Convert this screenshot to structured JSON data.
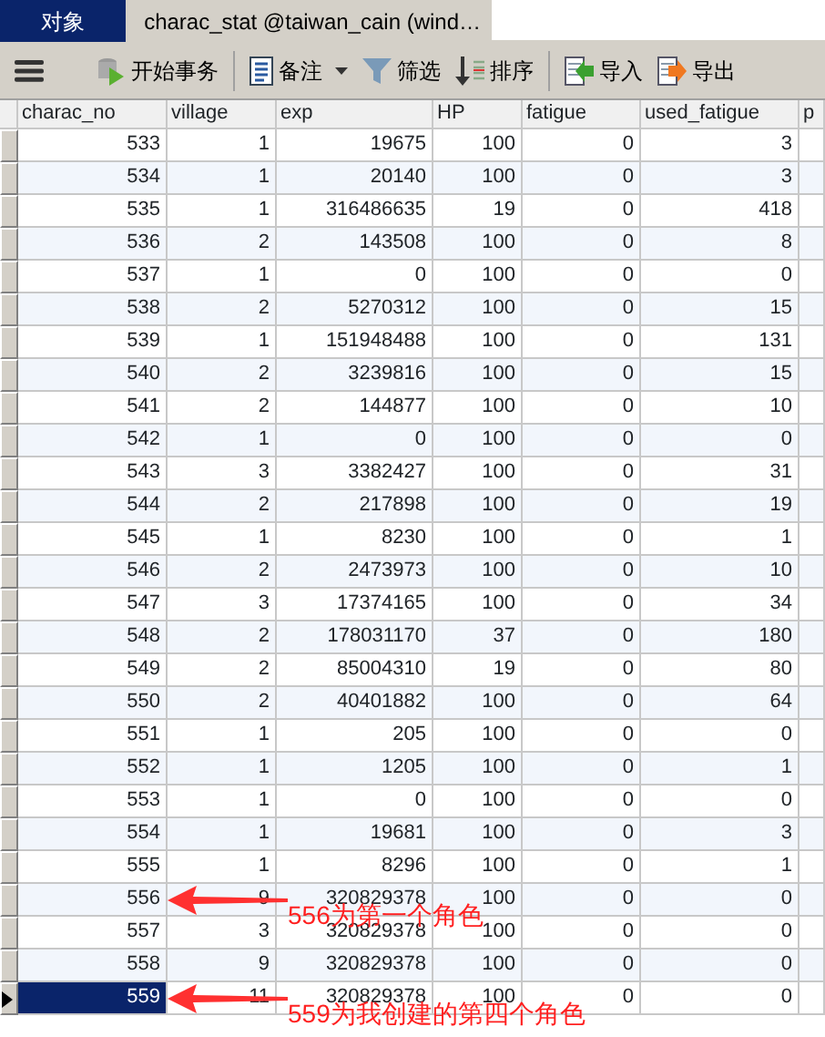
{
  "tabs": [
    {
      "label": "对象",
      "selected": true,
      "kind": "plain"
    },
    {
      "label": "charac_stat @taiwan_cain (wind…",
      "selected": false,
      "kind": "table"
    }
  ],
  "toolbar": [
    {
      "kind": "menu"
    },
    {
      "kind": "transaction",
      "label": "开始事务"
    },
    {
      "kind": "note",
      "label": "备注"
    },
    {
      "kind": "filter",
      "label": "筛选"
    },
    {
      "kind": "sort",
      "label": "排序"
    },
    {
      "kind": "import",
      "label": "导入"
    },
    {
      "kind": "export",
      "label": "导出"
    }
  ],
  "table": {
    "columns": [
      "charac_no",
      "village",
      "exp",
      "HP",
      "fatigue",
      "used_fatigue",
      "p"
    ],
    "rows": [
      {
        "cells": [
          "533",
          "1",
          "19675",
          "100",
          "0",
          "3"
        ],
        "selected": false
      },
      {
        "cells": [
          "534",
          "1",
          "20140",
          "100",
          "0",
          "3"
        ],
        "selected": false
      },
      {
        "cells": [
          "535",
          "1",
          "316486635",
          "19",
          "0",
          "418"
        ],
        "selected": false
      },
      {
        "cells": [
          "536",
          "2",
          "143508",
          "100",
          "0",
          "8"
        ],
        "selected": false
      },
      {
        "cells": [
          "537",
          "1",
          "0",
          "100",
          "0",
          "0"
        ],
        "selected": false
      },
      {
        "cells": [
          "538",
          "2",
          "5270312",
          "100",
          "0",
          "15"
        ],
        "selected": false
      },
      {
        "cells": [
          "539",
          "1",
          "151948488",
          "100",
          "0",
          "131"
        ],
        "selected": false
      },
      {
        "cells": [
          "540",
          "2",
          "3239816",
          "100",
          "0",
          "15"
        ],
        "selected": false
      },
      {
        "cells": [
          "541",
          "2",
          "144877",
          "100",
          "0",
          "10"
        ],
        "selected": false
      },
      {
        "cells": [
          "542",
          "1",
          "0",
          "100",
          "0",
          "0"
        ],
        "selected": false
      },
      {
        "cells": [
          "543",
          "3",
          "3382427",
          "100",
          "0",
          "31"
        ],
        "selected": false
      },
      {
        "cells": [
          "544",
          "2",
          "217898",
          "100",
          "0",
          "19"
        ],
        "selected": false
      },
      {
        "cells": [
          "545",
          "1",
          "8230",
          "100",
          "0",
          "1"
        ],
        "selected": false
      },
      {
        "cells": [
          "546",
          "2",
          "2473973",
          "100",
          "0",
          "10"
        ],
        "selected": false
      },
      {
        "cells": [
          "547",
          "3",
          "17374165",
          "100",
          "0",
          "34"
        ],
        "selected": false
      },
      {
        "cells": [
          "548",
          "2",
          "178031170",
          "37",
          "0",
          "180"
        ],
        "selected": false
      },
      {
        "cells": [
          "549",
          "2",
          "85004310",
          "19",
          "0",
          "80"
        ],
        "selected": false
      },
      {
        "cells": [
          "550",
          "2",
          "40401882",
          "100",
          "0",
          "64"
        ],
        "selected": false
      },
      {
        "cells": [
          "551",
          "1",
          "205",
          "100",
          "0",
          "0"
        ],
        "selected": false
      },
      {
        "cells": [
          "552",
          "1",
          "1205",
          "100",
          "0",
          "1"
        ],
        "selected": false
      },
      {
        "cells": [
          "553",
          "1",
          "0",
          "100",
          "0",
          "0"
        ],
        "selected": false
      },
      {
        "cells": [
          "554",
          "1",
          "19681",
          "100",
          "0",
          "3"
        ],
        "selected": false
      },
      {
        "cells": [
          "555",
          "1",
          "8296",
          "100",
          "0",
          "1"
        ],
        "selected": false
      },
      {
        "cells": [
          "556",
          "9",
          "320829378",
          "100",
          "0",
          "0"
        ],
        "selected": false,
        "note": "556为第一个角色"
      },
      {
        "cells": [
          "557",
          "3",
          "320829378",
          "100",
          "0",
          "0"
        ],
        "selected": false
      },
      {
        "cells": [
          "558",
          "9",
          "320829378",
          "100",
          "0",
          "0"
        ],
        "selected": false
      },
      {
        "cells": [
          "559",
          "11",
          "320829378",
          "100",
          "0",
          "0"
        ],
        "selected": true,
        "note": "559为我创建的第四个角色"
      }
    ]
  }
}
